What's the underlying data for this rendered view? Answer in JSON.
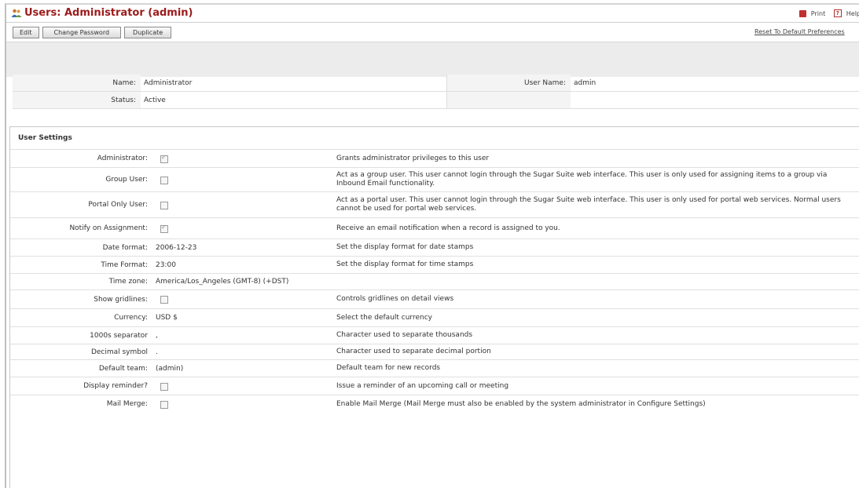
{
  "header": {
    "title": "Users: Administrator (admin)",
    "print_label": "Print",
    "help_label": "Help"
  },
  "toolbar": {
    "edit_label": "Edit",
    "change_password_label": "Change Password",
    "duplicate_label": "Duplicate",
    "reset_link": "Reset To Default Preferences"
  },
  "user_info": {
    "name_label": "Name:",
    "name_value": "Administrator",
    "user_name_label": "User Name:",
    "user_name_value": "admin",
    "status_label": "Status:",
    "status_value": "Active"
  },
  "settings": {
    "title": "User Settings",
    "rows": [
      {
        "label": "Administrator:",
        "checkbox": true,
        "checked": true,
        "value": "",
        "desc": "Grants administrator privileges to this user"
      },
      {
        "label": "Group User:",
        "checkbox": true,
        "checked": false,
        "value": "",
        "desc": "Act as a group user. This user cannot login through the Sugar Suite web interface. This user is only used for assigning items to a group via Inbound Email functionality."
      },
      {
        "label": "Portal Only User:",
        "checkbox": true,
        "checked": false,
        "value": "",
        "desc": "Act as a portal user. This user cannot login through the Sugar Suite web interface. This user is only used for portal web services. Normal users cannot be used for portal web services."
      },
      {
        "label": "Notify on Assignment:",
        "checkbox": true,
        "checked": true,
        "value": "",
        "desc": "Receive an email notification when a record is assigned to you."
      },
      {
        "label": "Date format:",
        "checkbox": false,
        "checked": false,
        "value": "2006-12-23",
        "desc": "Set the display format for date stamps"
      },
      {
        "label": "Time Format:",
        "checkbox": false,
        "checked": false,
        "value": "23:00",
        "desc": "Set the display format for time stamps"
      },
      {
        "label": "Time zone:",
        "checkbox": false,
        "checked": false,
        "value": "America/Los_Angeles (GMT-8) (+DST)",
        "desc": ""
      },
      {
        "label": "Show gridlines:",
        "checkbox": true,
        "checked": false,
        "value": "",
        "desc": "Controls gridlines on detail views"
      },
      {
        "label": "Currency:",
        "checkbox": false,
        "checked": false,
        "value": "USD $",
        "desc": "Select the default currency"
      },
      {
        "label": "1000s separator",
        "checkbox": false,
        "checked": false,
        "value": ",",
        "desc": "Character used to separate thousands"
      },
      {
        "label": "Decimal symbol",
        "checkbox": false,
        "checked": false,
        "value": ".",
        "desc": "Character used to separate decimal portion"
      },
      {
        "label": "Default team:",
        "checkbox": false,
        "checked": false,
        "value": "(admin)",
        "desc": "Default team for new records"
      },
      {
        "label": "Display reminder?",
        "checkbox": true,
        "checked": false,
        "value": "",
        "desc": "Issue a reminder of an upcoming call or meeting"
      },
      {
        "label": "Mail Merge:",
        "checkbox": true,
        "checked": false,
        "value": "",
        "desc": "Enable Mail Merge (Mail Merge must also be enabled by the system administrator in Configure Settings)"
      }
    ]
  },
  "colors": {
    "title": "#9c1b1b",
    "label_bg": "#f4f4f4",
    "strip_bg": "#ececec"
  },
  "icons": {
    "title": "users-icon",
    "print": "printer-icon",
    "help": "help-icon"
  }
}
